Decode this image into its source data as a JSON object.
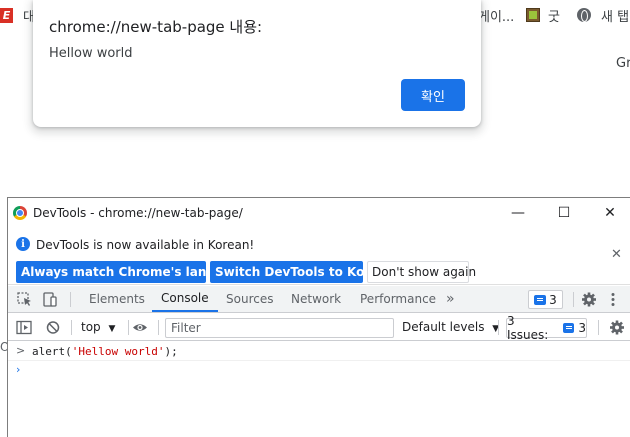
{
  "bookmarks": {
    "left_label": "대",
    "items": [
      {
        "label": "게이...",
        "icon": "bookmark-generic-icon"
      },
      {
        "label": "굿",
        "icon": "cube-icon"
      },
      {
        "label": "새 탭",
        "icon": "globe-icon"
      }
    ],
    "page_partial_text": "Gr"
  },
  "alert": {
    "title": "chrome://new-tab-page 내용:",
    "message": "Hellow world",
    "ok_label": "확인"
  },
  "devtools": {
    "window_title": "DevTools - chrome://new-tab-page/",
    "window_controls": {
      "minimize": "—",
      "maximize": "☐",
      "close": "✕"
    },
    "infobar": {
      "message": "DevTools is now available in Korean!",
      "buttons": {
        "match_language": "Always match Chrome's language",
        "switch_korean": "Switch DevTools to Korean",
        "dont_show": "Don't show again"
      },
      "close": "✕"
    },
    "tabs": [
      "Elements",
      "Console",
      "Sources",
      "Network",
      "Performance"
    ],
    "active_tab": "Console",
    "more_tabs": "»",
    "issues_badge_count": "3",
    "console_toolbar": {
      "context": "top",
      "filter_placeholder": "Filter",
      "levels": "Default levels",
      "issues_label": "3 Issues:",
      "issues_count": "3"
    },
    "console": {
      "entry_prefix": "alert(",
      "entry_string": "'Hellow world'",
      "entry_suffix": ");",
      "prompt": "›"
    }
  },
  "colors": {
    "accent": "#1a73e8",
    "console_string": "#c80000"
  }
}
